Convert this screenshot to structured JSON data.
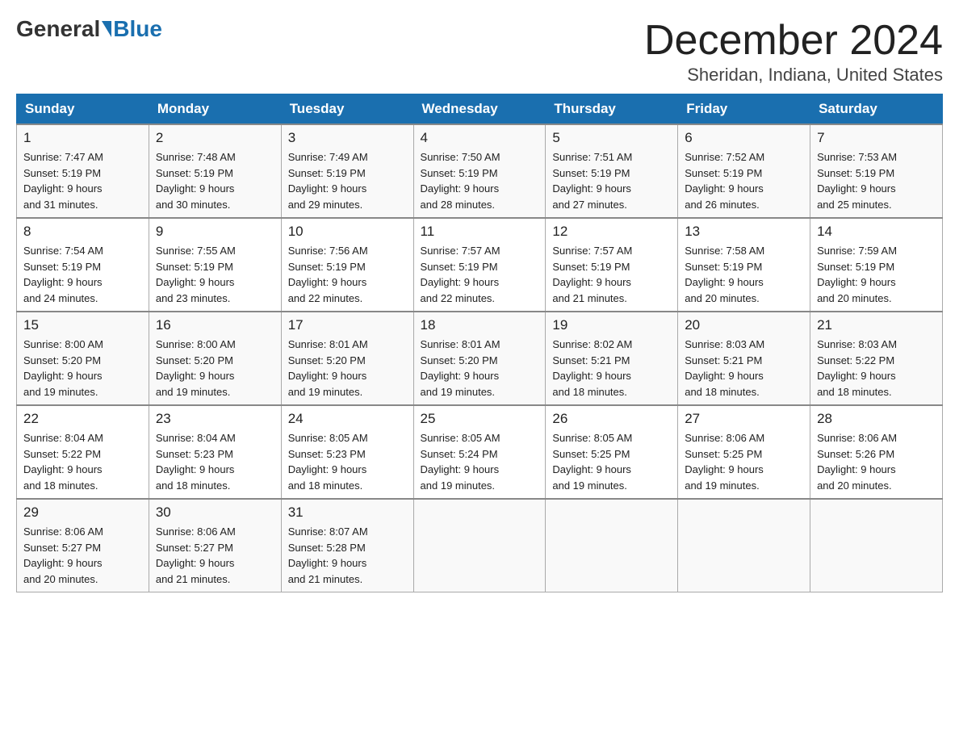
{
  "header": {
    "logo_general": "General",
    "logo_blue": "Blue",
    "month": "December 2024",
    "location": "Sheridan, Indiana, United States"
  },
  "days_of_week": [
    "Sunday",
    "Monday",
    "Tuesday",
    "Wednesday",
    "Thursday",
    "Friday",
    "Saturday"
  ],
  "weeks": [
    [
      {
        "day": "1",
        "sunrise": "7:47 AM",
        "sunset": "5:19 PM",
        "daylight": "9 hours and 31 minutes."
      },
      {
        "day": "2",
        "sunrise": "7:48 AM",
        "sunset": "5:19 PM",
        "daylight": "9 hours and 30 minutes."
      },
      {
        "day": "3",
        "sunrise": "7:49 AM",
        "sunset": "5:19 PM",
        "daylight": "9 hours and 29 minutes."
      },
      {
        "day": "4",
        "sunrise": "7:50 AM",
        "sunset": "5:19 PM",
        "daylight": "9 hours and 28 minutes."
      },
      {
        "day": "5",
        "sunrise": "7:51 AM",
        "sunset": "5:19 PM",
        "daylight": "9 hours and 27 minutes."
      },
      {
        "day": "6",
        "sunrise": "7:52 AM",
        "sunset": "5:19 PM",
        "daylight": "9 hours and 26 minutes."
      },
      {
        "day": "7",
        "sunrise": "7:53 AM",
        "sunset": "5:19 PM",
        "daylight": "9 hours and 25 minutes."
      }
    ],
    [
      {
        "day": "8",
        "sunrise": "7:54 AM",
        "sunset": "5:19 PM",
        "daylight": "9 hours and 24 minutes."
      },
      {
        "day": "9",
        "sunrise": "7:55 AM",
        "sunset": "5:19 PM",
        "daylight": "9 hours and 23 minutes."
      },
      {
        "day": "10",
        "sunrise": "7:56 AM",
        "sunset": "5:19 PM",
        "daylight": "9 hours and 22 minutes."
      },
      {
        "day": "11",
        "sunrise": "7:57 AM",
        "sunset": "5:19 PM",
        "daylight": "9 hours and 22 minutes."
      },
      {
        "day": "12",
        "sunrise": "7:57 AM",
        "sunset": "5:19 PM",
        "daylight": "9 hours and 21 minutes."
      },
      {
        "day": "13",
        "sunrise": "7:58 AM",
        "sunset": "5:19 PM",
        "daylight": "9 hours and 20 minutes."
      },
      {
        "day": "14",
        "sunrise": "7:59 AM",
        "sunset": "5:19 PM",
        "daylight": "9 hours and 20 minutes."
      }
    ],
    [
      {
        "day": "15",
        "sunrise": "8:00 AM",
        "sunset": "5:20 PM",
        "daylight": "9 hours and 19 minutes."
      },
      {
        "day": "16",
        "sunrise": "8:00 AM",
        "sunset": "5:20 PM",
        "daylight": "9 hours and 19 minutes."
      },
      {
        "day": "17",
        "sunrise": "8:01 AM",
        "sunset": "5:20 PM",
        "daylight": "9 hours and 19 minutes."
      },
      {
        "day": "18",
        "sunrise": "8:01 AM",
        "sunset": "5:20 PM",
        "daylight": "9 hours and 19 minutes."
      },
      {
        "day": "19",
        "sunrise": "8:02 AM",
        "sunset": "5:21 PM",
        "daylight": "9 hours and 18 minutes."
      },
      {
        "day": "20",
        "sunrise": "8:03 AM",
        "sunset": "5:21 PM",
        "daylight": "9 hours and 18 minutes."
      },
      {
        "day": "21",
        "sunrise": "8:03 AM",
        "sunset": "5:22 PM",
        "daylight": "9 hours and 18 minutes."
      }
    ],
    [
      {
        "day": "22",
        "sunrise": "8:04 AM",
        "sunset": "5:22 PM",
        "daylight": "9 hours and 18 minutes."
      },
      {
        "day": "23",
        "sunrise": "8:04 AM",
        "sunset": "5:23 PM",
        "daylight": "9 hours and 18 minutes."
      },
      {
        "day": "24",
        "sunrise": "8:05 AM",
        "sunset": "5:23 PM",
        "daylight": "9 hours and 18 minutes."
      },
      {
        "day": "25",
        "sunrise": "8:05 AM",
        "sunset": "5:24 PM",
        "daylight": "9 hours and 19 minutes."
      },
      {
        "day": "26",
        "sunrise": "8:05 AM",
        "sunset": "5:25 PM",
        "daylight": "9 hours and 19 minutes."
      },
      {
        "day": "27",
        "sunrise": "8:06 AM",
        "sunset": "5:25 PM",
        "daylight": "9 hours and 19 minutes."
      },
      {
        "day": "28",
        "sunrise": "8:06 AM",
        "sunset": "5:26 PM",
        "daylight": "9 hours and 20 minutes."
      }
    ],
    [
      {
        "day": "29",
        "sunrise": "8:06 AM",
        "sunset": "5:27 PM",
        "daylight": "9 hours and 20 minutes."
      },
      {
        "day": "30",
        "sunrise": "8:06 AM",
        "sunset": "5:27 PM",
        "daylight": "9 hours and 21 minutes."
      },
      {
        "day": "31",
        "sunrise": "8:07 AM",
        "sunset": "5:28 PM",
        "daylight": "9 hours and 21 minutes."
      },
      null,
      null,
      null,
      null
    ]
  ],
  "labels": {
    "sunrise": "Sunrise:",
    "sunset": "Sunset:",
    "daylight": "Daylight: 9 hours"
  }
}
